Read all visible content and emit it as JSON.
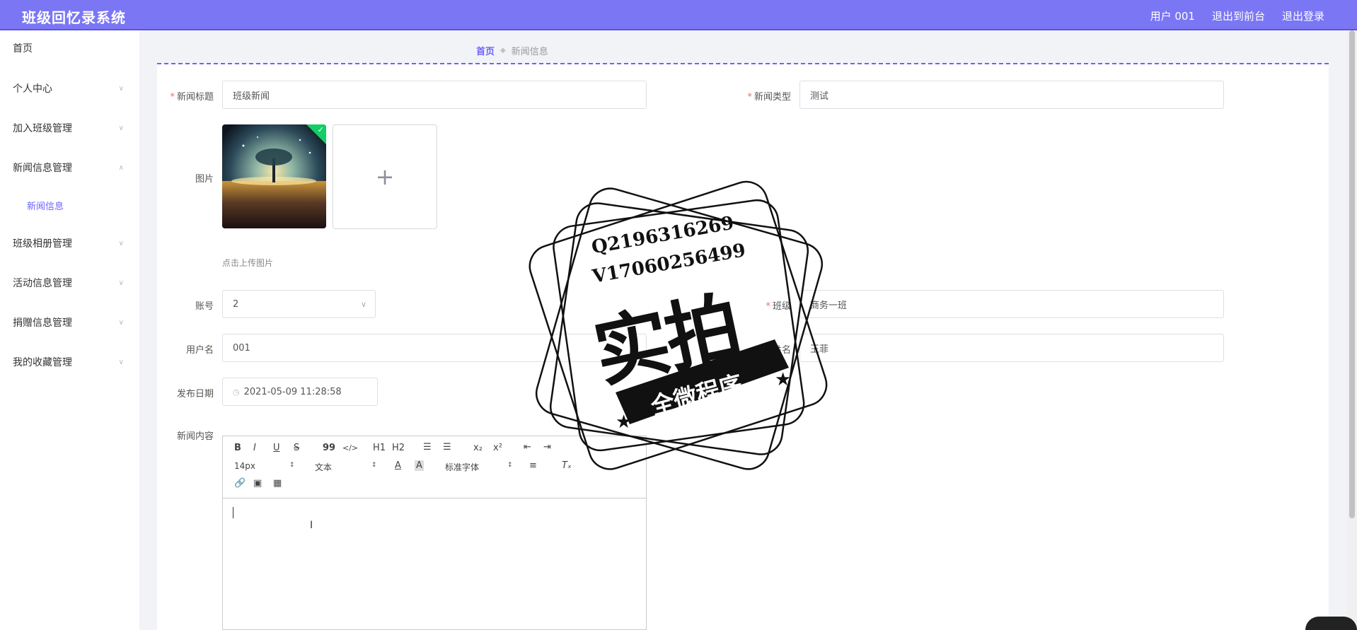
{
  "app": {
    "title": "班级回忆录系统",
    "user_label": "用户 001",
    "back_to_front": "退出到前台",
    "logout": "退出登录"
  },
  "sidebar": {
    "items": [
      {
        "label": "首页"
      },
      {
        "label": "个人中心"
      },
      {
        "label": "加入班级管理"
      },
      {
        "label": "新闻信息管理"
      },
      {
        "label": "新闻信息"
      },
      {
        "label": "班级相册管理"
      },
      {
        "label": "活动信息管理"
      },
      {
        "label": "捐赠信息管理"
      },
      {
        "label": "我的收藏管理"
      }
    ]
  },
  "breadcrumb": {
    "home": "首页",
    "current": "新闻信息"
  },
  "form": {
    "title_label": "新闻标题",
    "title_value": "班级新闻",
    "type_label": "新闻类型",
    "type_value": "测试",
    "image_label": "图片",
    "upload_hint": "点击上传图片",
    "upload_plus": "+",
    "account_label": "账号",
    "account_value": "2",
    "class_label": "班级",
    "class_value": "商务一班",
    "username_label": "用户名",
    "username_value": "001",
    "name_label": "姓名",
    "name_value": "王菲",
    "date_label": "发布日期",
    "date_value": "2021-05-09 11:28:58",
    "content_label": "新闻内容",
    "required_mark": "*"
  },
  "editor": {
    "font_size": "14px",
    "header_select": "文本",
    "font_family": "标准字体",
    "buttons": [
      "B",
      "I",
      "U",
      "S",
      "99",
      "</>",
      "H1",
      "H2",
      "ordered-list",
      "bullet-list",
      "x₂",
      "x²",
      "outdent",
      "indent"
    ]
  },
  "watermark": {
    "qq": "Q2196316269",
    "vx": "V17060256499",
    "big": "实拍",
    "ribbon": "全微程序"
  },
  "colors": {
    "topbar": "#7a76f4",
    "accent": "#6c63ff",
    "required": "#f56c6c",
    "success": "#13ce66"
  }
}
